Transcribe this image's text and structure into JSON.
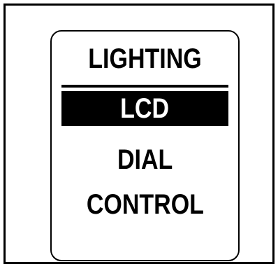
{
  "screen": {
    "title": "LIGHTING",
    "menu_items": [
      {
        "label": "LCD",
        "selected": true
      },
      {
        "label": "DIAL",
        "selected": false
      },
      {
        "label": "CONTROL",
        "selected": false
      }
    ]
  },
  "colors": {
    "foreground": "#000000",
    "background": "#ffffff",
    "highlight": "#000000",
    "highlight_text": "#ffffff"
  }
}
